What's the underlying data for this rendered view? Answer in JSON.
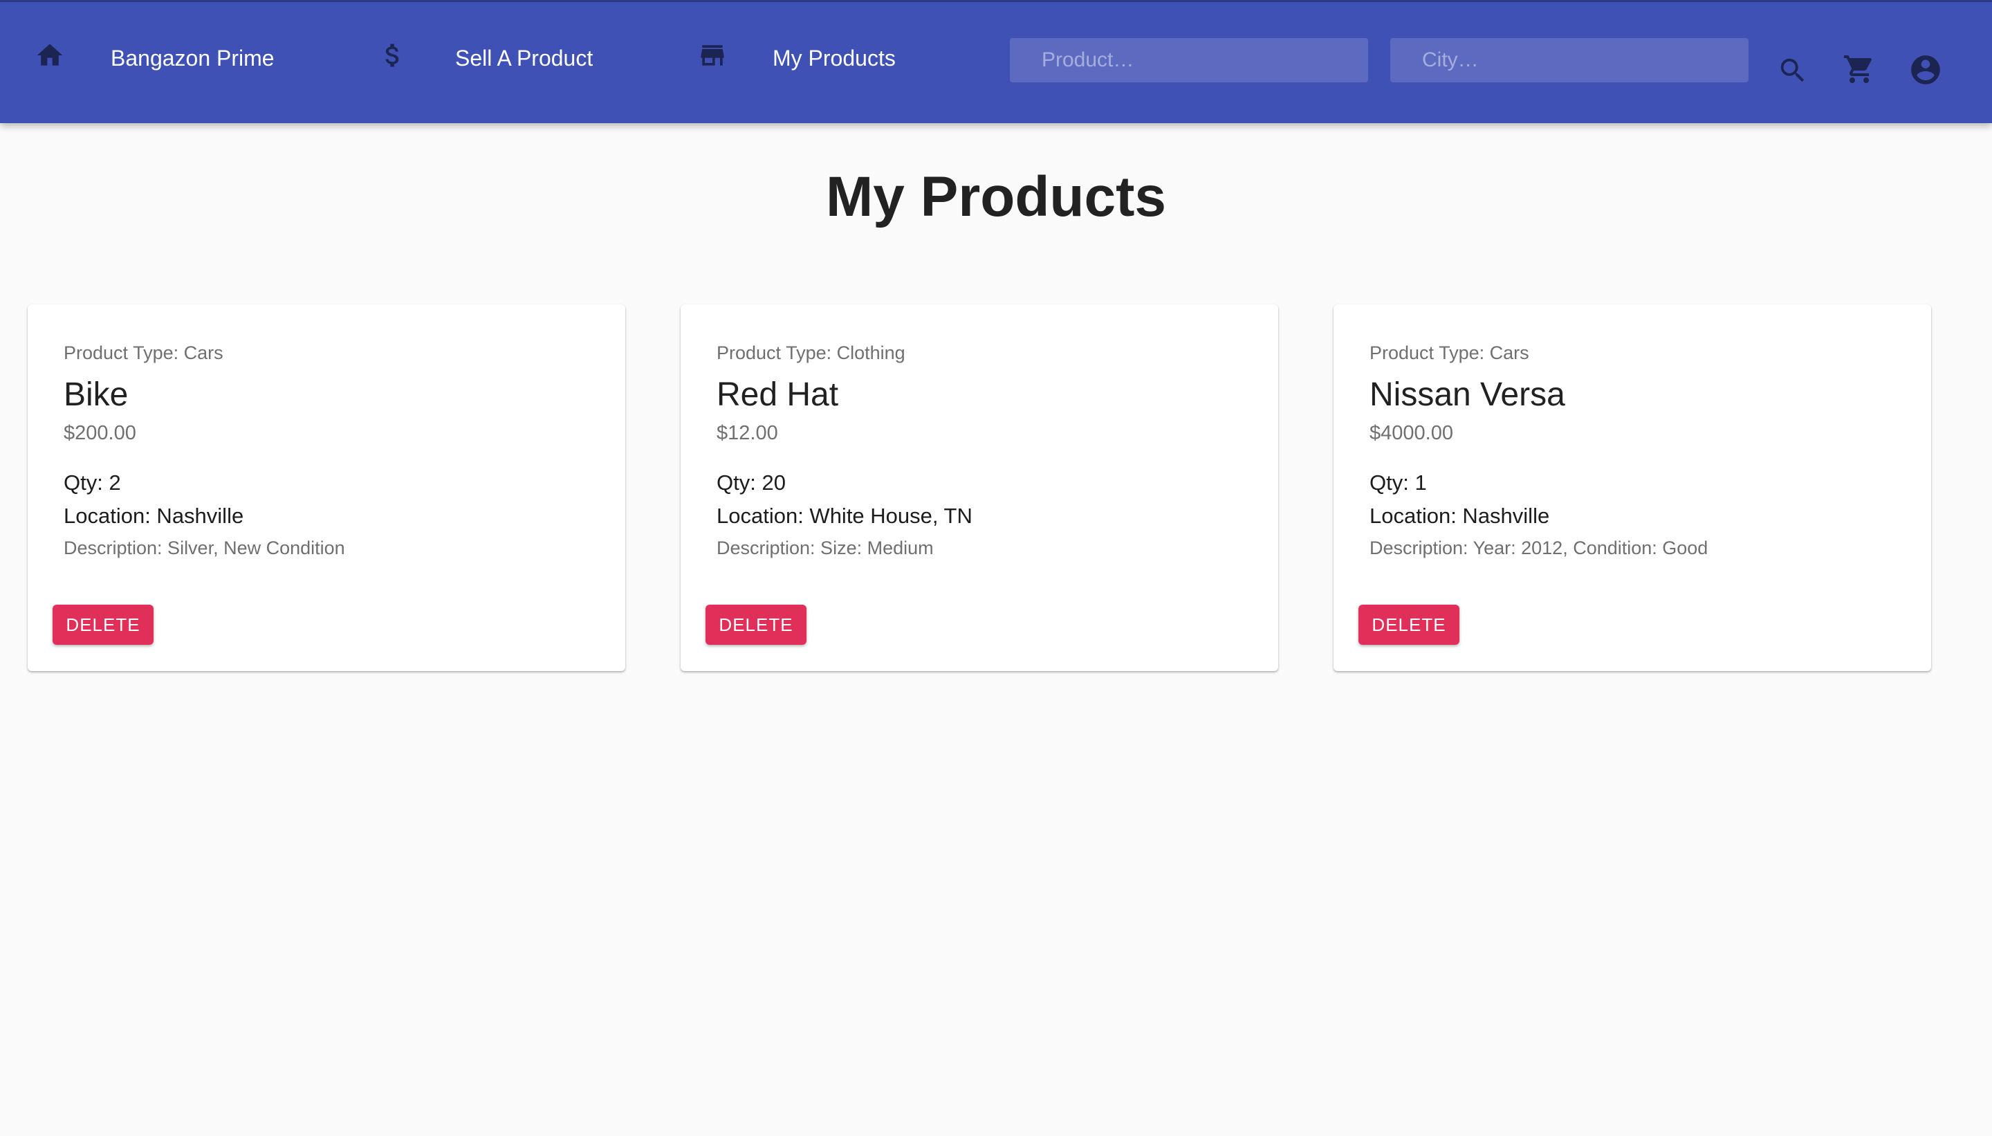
{
  "nav": {
    "home_icon": "home-icon",
    "home_label": "Bangazon Prime",
    "sell_icon": "dollar-icon",
    "sell_label": "Sell A Product",
    "store_icon": "store-icon",
    "my_products_label": "My Products",
    "product_search_placeholder": "Product…",
    "city_search_placeholder": "City…",
    "search_icon": "search-icon",
    "cart_icon": "shopping-cart-icon",
    "account_icon": "account-circle-icon"
  },
  "page": {
    "title": "My Products"
  },
  "products": [
    {
      "type": "Product Type: Cars",
      "name": "Bike",
      "price": "$200.00",
      "qty": "Qty: 2",
      "location": "Location: Nashville",
      "description": "Description: Silver, New Condition",
      "delete_label": "DELETE"
    },
    {
      "type": "Product Type: Clothing",
      "name": "Red Hat",
      "price": "$12.00",
      "qty": "Qty: 20",
      "location": "Location: White House, TN",
      "description": "Description: Size: Medium",
      "delete_label": "DELETE"
    },
    {
      "type": "Product Type: Cars",
      "name": "Nissan Versa",
      "price": "$4000.00",
      "qty": "Qty: 1",
      "location": "Location: Nashville",
      "description": "Description: Year: 2012, Condition: Good",
      "delete_label": "DELETE"
    }
  ],
  "colors": {
    "appbar": "#3f51b5",
    "nav_icon": "#1c2452",
    "delete_button": "#e0305a",
    "background": "#fafafa"
  }
}
